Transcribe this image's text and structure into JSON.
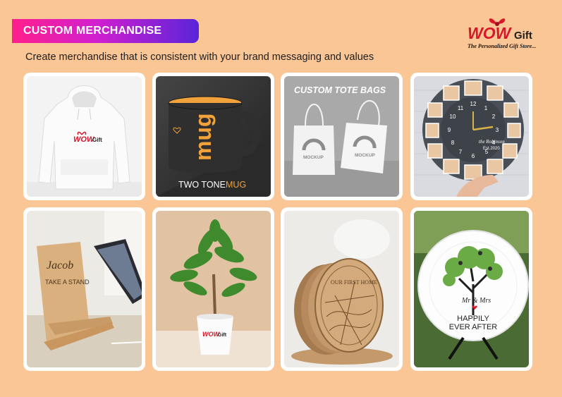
{
  "header": {
    "title": "CUSTOM MERCHANDISE",
    "subtitle": "Create merchandise that is consistent with your brand messaging and values"
  },
  "logo": {
    "word": "WOW",
    "gift": "Gift",
    "tagline": "The Personalized Gift Store..."
  },
  "products": {
    "hoodie": {
      "print_word": "WOW",
      "print_gift": "Gift"
    },
    "mug": {
      "mug_text": "mug",
      "caption_a": "TWO TONE",
      "caption_b": "MUG"
    },
    "tote": {
      "title": "CUSTOM TOTE BAGS",
      "mockup": "MOCKUP"
    },
    "clock": {
      "script": "the Robinson",
      "est": "Est.2020"
    },
    "stand": {
      "name": "Jacob",
      "line": "TAKE A STAND"
    },
    "plant": {
      "pot_word": "WOW",
      "pot_gift": "Gift"
    },
    "coaster": {
      "line": "OUR FIRST HOME"
    },
    "plate": {
      "names": "Mr & Mrs",
      "line1": "HAPPILY",
      "line2": "EVER AFTER"
    }
  },
  "colors": {
    "background": "#fbc696",
    "banner_start": "#ff1f8a",
    "banner_end": "#5a24d8",
    "brand_red": "#d7172a",
    "mug_orange": "#f2a23a"
  }
}
